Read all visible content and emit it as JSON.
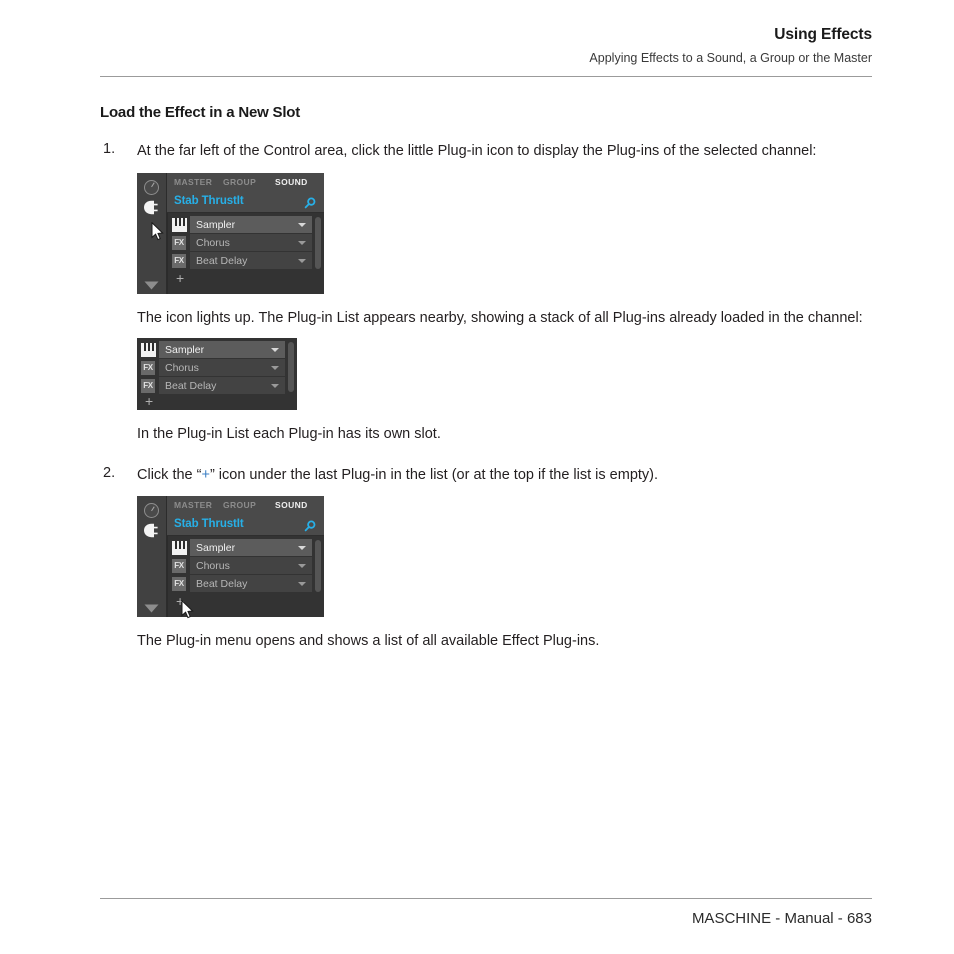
{
  "header": {
    "title": "Using Effects",
    "subtitle": "Applying Effects to a Sound, a Group or the Master"
  },
  "section": {
    "title": "Load the Effect in a New Slot"
  },
  "steps": [
    {
      "number": "1.",
      "text": "At the far left of the Control area, click the little Plug-in icon to display the Plug-ins of the selected channel:"
    },
    {
      "number": "2.",
      "text_before": "Click the “",
      "accent": "+",
      "text_after": "” icon under the last Plug-in in the list (or at the top if the list is empty)."
    }
  ],
  "paragraphs": {
    "after_step1": "The icon lights up. The Plug-in List appears nearby, showing a stack of all Plug-ins already loaded in the channel:",
    "after_list": "In the Plug-in List each Plug-in has its own slot.",
    "after_step2": "The Plug-in menu opens and shows a list of all available Effect Plug-ins."
  },
  "widget": {
    "tabs": [
      {
        "label": "MASTER",
        "active": false
      },
      {
        "label": "GROUP",
        "active": false
      },
      {
        "label": "SOUND",
        "active": true
      }
    ],
    "channel_name": "Stab ThrustIt",
    "slots": [
      {
        "icon": "keyboard-icon",
        "badge": "",
        "label": "Sampler",
        "selected": true
      },
      {
        "icon": "fx-icon",
        "badge": "FX",
        "label": "Chorus",
        "selected": false
      },
      {
        "icon": "fx-icon",
        "badge": "FX",
        "label": "Beat Delay",
        "selected": false
      }
    ],
    "add_label": "+",
    "icons": {
      "knob": "knob-icon",
      "plug": "plug-icon",
      "chevron": "chevron-down-icon",
      "search": "search-icon"
    },
    "colors": {
      "accent_cyan": "#27b0e8",
      "panel_bg": "#3b3b3b",
      "list_bg": "#333333",
      "selected_row": "#5c5c5c"
    }
  },
  "footer": {
    "text": "MASCHINE - Manual - 683"
  }
}
